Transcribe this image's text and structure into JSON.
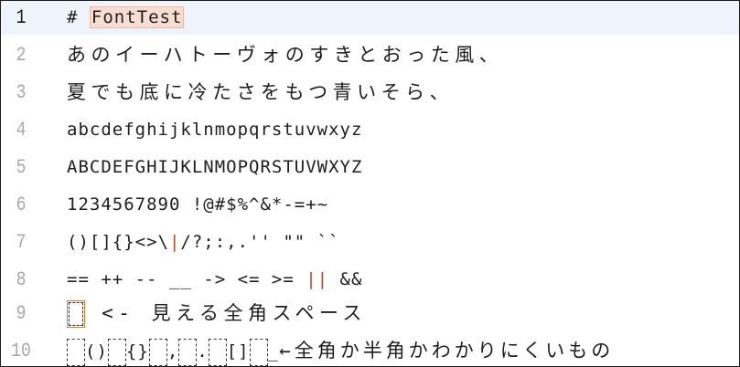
{
  "editor": {
    "lines": [
      {
        "num": "1",
        "color": "#1a1a1a",
        "text": "# ",
        "highlight": "FontTest"
      },
      {
        "num": "2",
        "color": "#a8a8a8",
        "text": "あのイーハトーヴォのすきとおった風、"
      },
      {
        "num": "3",
        "color": "#a8a8a8",
        "text": "夏でも底に冷たさをもつ青いそら、"
      },
      {
        "num": "4",
        "color": "#a8a8a8",
        "text": "abcdefghijklnmopqrstuvwxyz"
      },
      {
        "num": "5",
        "color": "#a8a8a8",
        "text": "ABCDEFGHIJKLNMOPQRSTUVWXYZ"
      },
      {
        "num": "6",
        "color": "#a8a8a8",
        "text": "1234567890 !@#$%^&*-=+~"
      },
      {
        "num": "7",
        "color": "#a8a8a8",
        "a": "()[]{}<>\\",
        "bar": "|",
        "b": "/?;:,.'' \"\" ``"
      },
      {
        "num": "8",
        "color": "#a8a8a8",
        "a": "== ++ -- __ -> <= >= ",
        "bar": "||",
        "b": " &&"
      },
      {
        "num": "9",
        "color": "#a8a8a8",
        "text": " <- 見える全角スペース"
      },
      {
        "num": "10",
        "color": "#a8a8a8",
        "p1": "(",
        "p2": ")",
        "b1": "{",
        "b2": "}",
        "c": ",",
        "d": ".",
        "k1": "[",
        "k2": "]",
        "u": "_",
        "tail": "←全角か半角かわかりにくいもの"
      }
    ]
  }
}
